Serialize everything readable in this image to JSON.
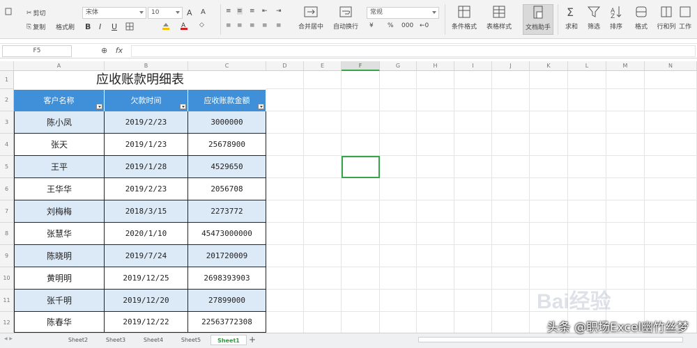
{
  "toolbar": {
    "cut": "剪切",
    "copy": "复制",
    "format_painter": "格式刷",
    "font_name": "宋体",
    "font_size": "10",
    "number_format": "常规",
    "merge_center": "合并居中",
    "wrap_text": "自动换行",
    "conditional_format": "条件格式",
    "table_style": "表格样式",
    "document_assistant": "文档助手",
    "sum": "求和",
    "filter": "筛选",
    "sort": "排序",
    "format": "格式",
    "rows_cols": "行和列",
    "worksheet": "工作"
  },
  "formula_bar": {
    "name_box": "F5",
    "fx": "fx",
    "value": ""
  },
  "columns": [
    "A",
    "B",
    "C",
    "D",
    "E",
    "F",
    "G",
    "H",
    "I",
    "J",
    "K",
    "L",
    "M",
    "N"
  ],
  "rows": [
    "1",
    "2",
    "3",
    "4",
    "5",
    "6",
    "7",
    "8",
    "9",
    "10",
    "11",
    "12"
  ],
  "sheet": {
    "title": "应收账款明细表",
    "headers": [
      "客户名称",
      "欠款时间",
      "应收账款金额"
    ],
    "data": [
      [
        "陈小凤",
        "2019/2/23",
        "3000000"
      ],
      [
        "张天",
        "2019/1/23",
        "25678900"
      ],
      [
        "王平",
        "2019/1/28",
        "4529650"
      ],
      [
        "王华华",
        "2019/2/23",
        "2056708"
      ],
      [
        "刘梅梅",
        "2018/3/15",
        "2273772"
      ],
      [
        "张慧华",
        "2020/1/10",
        "45473000000"
      ],
      [
        "陈晓明",
        "2019/7/24",
        "201720009"
      ],
      [
        "黄明明",
        "2019/12/25",
        "2698393903"
      ],
      [
        "张千明",
        "2019/12/20",
        "27899000"
      ],
      [
        "陈春华",
        "2019/12/22",
        "22563772308"
      ]
    ]
  },
  "sheet_tabs": [
    "Sheet2",
    "Sheet3",
    "Sheet4",
    "Sheet5",
    "Sheet1"
  ],
  "active_tab": "Sheet1",
  "add_tab": "+",
  "watermark": "头条 @职场Excel幽竹丝梦",
  "baidu_mark": "Bai经验",
  "colors": {
    "header_blue": "#3f8fd9",
    "alt_row": "#dce9f6",
    "selection_green": "#37a34a"
  }
}
